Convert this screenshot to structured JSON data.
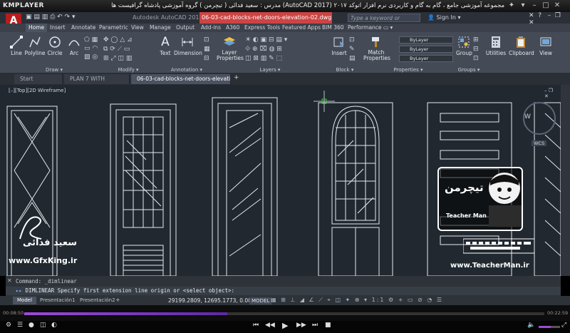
{
  "player": {
    "logo": "KMPLAYER",
    "caption": "مجموعه آموزشی جامع ، گام به گام و کاربردی نرم افزار  اتوکد ۲۰۱۷ (AutoCAD 2017)  مدرس : سعید فدائی ( تیچرمن ) گروه آموزشی پادشاه گرافیست ها",
    "time_elapsed": "00:08:50",
    "time_total": "00:22:59",
    "progress_fraction": 0.39,
    "volume_fraction": 0.55,
    "controls": [
      "prev",
      "rewind",
      "play",
      "forward",
      "next",
      "stop"
    ]
  },
  "app": {
    "logo": "A",
    "window_title": "Autodesk AutoCAD 2017",
    "file_title": "06-03-cad-blocks-net-doors-elevation-02.dwg",
    "search_placeholder": "Type a keyword or phrase",
    "sign_in": "Sign In"
  },
  "ribbon": {
    "tabs": [
      "Home",
      "Insert",
      "Annotate",
      "Parametric",
      "View",
      "Manage",
      "Output",
      "Add-ins",
      "A360",
      "Express Tools",
      "Featured Apps",
      "BIM 360",
      "Performance"
    ],
    "draw": {
      "label": "Draw ▾",
      "buttons": [
        "Line",
        "Polyline",
        "Circle",
        "Arc"
      ]
    },
    "modify": {
      "label": "Modify ▾"
    },
    "annotation": {
      "label": "Annotation ▾",
      "buttons": [
        "Text",
        "Dimension"
      ]
    },
    "layers": {
      "label": "Layers ▾",
      "button": "Layer Properties"
    },
    "block": {
      "label": "Block ▾",
      "button": "Insert"
    },
    "properties": {
      "label": "Properties ▾",
      "button": "Match Properties",
      "dropdowns": [
        "ByLayer",
        "ByLayer",
        "ByLayer"
      ]
    },
    "groups": {
      "label": "Groups ▾",
      "button": "Group"
    },
    "utilities": "Utilities",
    "clipboard": "Clipboard",
    "view": "View"
  },
  "file_tabs": [
    "Start",
    "PLAN 7 WITH LAYER*",
    "06-03-cad-blocks-net-doors-elevation-02*"
  ],
  "viewport": {
    "label": "[–][Top][2D Wireframe]",
    "viewcube": "W",
    "wcs": "WCS"
  },
  "command": {
    "history": "Command: _dimlinear",
    "prompt": "DIMLINEAR Specify first extension line origin or <select object>:"
  },
  "layout_tabs": [
    "Model",
    "Presentación1",
    "Presentación2"
  ],
  "status": {
    "coords": "29199.2809, 12695.1773, 0.0000",
    "model": "MODEL"
  },
  "watermarks": {
    "left_name": "سعید فدائی",
    "left_site": "www.GfxKing.ir",
    "right_logo": "تیچرمن",
    "right_logo_en": "Teacher Man",
    "right_site": "www.TeacherMan.ir"
  }
}
